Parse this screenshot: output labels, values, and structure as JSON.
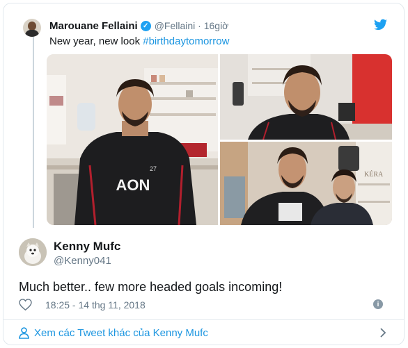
{
  "quoted_tweet": {
    "name": "Marouane Fellaini",
    "handle": "@Fellaini · 16giờ",
    "text": "New year, new look ",
    "hashtag": "#birthdaytomorrow",
    "shirt_sponsor": "AON",
    "shirt_number": "27",
    "sign_text": "KÉRA"
  },
  "reply": {
    "name": "Kenny Mufc",
    "handle": "@Kenny041",
    "text": "Much better.. few more headed goals incoming!",
    "timestamp": "18:25 - 14 thg 11, 2018"
  },
  "footer": {
    "more_label": "Xem các Tweet khác của Kenny Mufc"
  },
  "colors": {
    "accent": "#1da1f2",
    "link": "#1b95e0",
    "secondary_text": "#657786"
  }
}
